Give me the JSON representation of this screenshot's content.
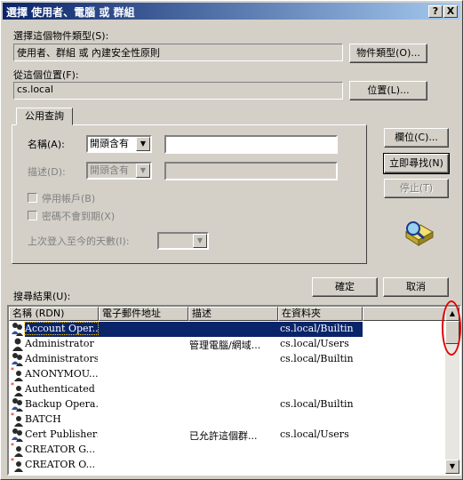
{
  "window": {
    "title": "選擇 使用者、電腦 或 群組",
    "help_button": "?",
    "close_button": "X"
  },
  "object_type": {
    "label": "選擇這個物件類型(S):",
    "value": "使用者、群組 或 內建安全性原則",
    "button": "物件類型(O)..."
  },
  "location": {
    "label": "從這個位置(F):",
    "value": "cs.local",
    "button": "位置(L)..."
  },
  "query_tab": {
    "label": "公用查詢",
    "name_label": "名稱(A):",
    "name_mode": "開頭含有",
    "name_value": "",
    "desc_label": "描述(D):",
    "desc_mode": "開頭含有",
    "desc_value": "",
    "disabled_accounts": "停用帳戶(B)",
    "non_expiring_passwords": "密碼不會到期(X)",
    "days_since_logon_label": "上次登入至今的天數(I):",
    "days_since_logon_value": ""
  },
  "side_buttons": {
    "columns": "欄位(C)...",
    "find_now": "立即尋找(N)",
    "stop": "停止(T)"
  },
  "dialog_buttons": {
    "ok": "確定",
    "cancel": "取消"
  },
  "results": {
    "label": "搜尋結果(U):",
    "columns": [
      "名稱 (RDN)",
      "電子郵件地址",
      "描述",
      "在資料夾"
    ],
    "rows": [
      {
        "name": "Account Oper...",
        "email": "",
        "desc": "",
        "folder": "cs.local/Builtin",
        "icon": "group-icon",
        "selected": true
      },
      {
        "name": "Administrator",
        "email": "",
        "desc": "管理電腦/網域...",
        "folder": "cs.local/Users",
        "icon": "user-icon",
        "selected": false
      },
      {
        "name": "Administrators",
        "email": "",
        "desc": "",
        "folder": "cs.local/Builtin",
        "icon": "group-icon",
        "selected": false
      },
      {
        "name": "ANONYMOU...",
        "email": "",
        "desc": "",
        "folder": "",
        "icon": "security-principal-icon",
        "selected": false
      },
      {
        "name": "Authenticated ...",
        "email": "",
        "desc": "",
        "folder": "",
        "icon": "security-principal-icon",
        "selected": false
      },
      {
        "name": "Backup Opera...",
        "email": "",
        "desc": "",
        "folder": "cs.local/Builtin",
        "icon": "group-icon",
        "selected": false
      },
      {
        "name": "BATCH",
        "email": "",
        "desc": "",
        "folder": "",
        "icon": "security-principal-icon",
        "selected": false
      },
      {
        "name": "Cert Publishers",
        "email": "",
        "desc": "已允許這個群...",
        "folder": "cs.local/Users",
        "icon": "group-icon",
        "selected": false
      },
      {
        "name": "CREATOR G...",
        "email": "",
        "desc": "",
        "folder": "",
        "icon": "security-principal-icon",
        "selected": false
      },
      {
        "name": "CREATOR O...",
        "email": "",
        "desc": "",
        "folder": "",
        "icon": "security-principal-icon",
        "selected": false
      }
    ]
  }
}
